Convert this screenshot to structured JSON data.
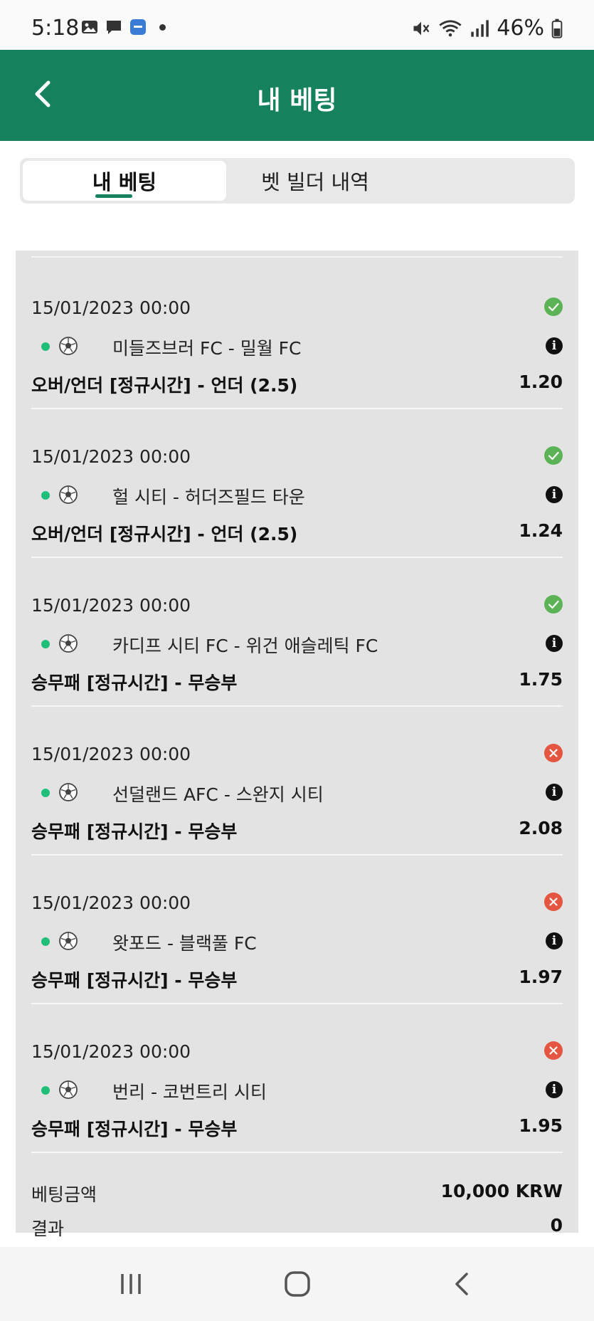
{
  "status_bar": {
    "time": "5:18",
    "battery": "46%",
    "icons": [
      "gallery-icon",
      "chat-icon",
      "app-icon",
      "dot-icon",
      "mute-icon",
      "wifi-icon",
      "signal-icon",
      "battery-icon"
    ]
  },
  "header": {
    "title": "내 베팅",
    "back_icon": "chevron-left-icon"
  },
  "tabs": [
    {
      "label": "내 베팅",
      "active": true
    },
    {
      "label": "벳 빌더 내역",
      "active": false
    }
  ],
  "bets": [
    {
      "date": "15/01/2023 00:00",
      "status": "won",
      "match": "미들즈브러 FC - 밀월 FC",
      "market": "오버/언더 [정규시간] - 언더 (2.5)",
      "odds": "1.20"
    },
    {
      "date": "15/01/2023 00:00",
      "status": "won",
      "match": "헐 시티 - 허더즈필드 타운",
      "market": "오버/언더 [정규시간] - 언더 (2.5)",
      "odds": "1.24"
    },
    {
      "date": "15/01/2023 00:00",
      "status": "won",
      "match": "카디프 시티 FC - 위건 애슬레틱 FC",
      "market": "승무패 [정규시간] - 무승부",
      "odds": "1.75"
    },
    {
      "date": "15/01/2023 00:00",
      "status": "lost",
      "match": "선덜랜드 AFC - 스완지 시티",
      "market": "승무패 [정규시간] - 무승부",
      "odds": "2.08"
    },
    {
      "date": "15/01/2023 00:00",
      "status": "lost",
      "match": "왓포드 - 블랙풀 FC",
      "market": "승무패 [정규시간] - 무승부",
      "odds": "1.97"
    },
    {
      "date": "15/01/2023 00:00",
      "status": "lost",
      "match": "번리 - 코번트리 시티",
      "market": "승무패 [정규시간] - 무승부",
      "odds": "1.95"
    }
  ],
  "summary": {
    "stake_label": "베팅금액",
    "stake_value": "10,000 KRW",
    "result_label": "결과",
    "result_value": "0"
  },
  "colors": {
    "brand_green": "#16825d",
    "won": "#5cb356",
    "lost": "#e45641",
    "live_dot": "#1fbf7a"
  },
  "nav_bar": [
    "recent-apps-icon",
    "home-icon",
    "back-icon"
  ]
}
